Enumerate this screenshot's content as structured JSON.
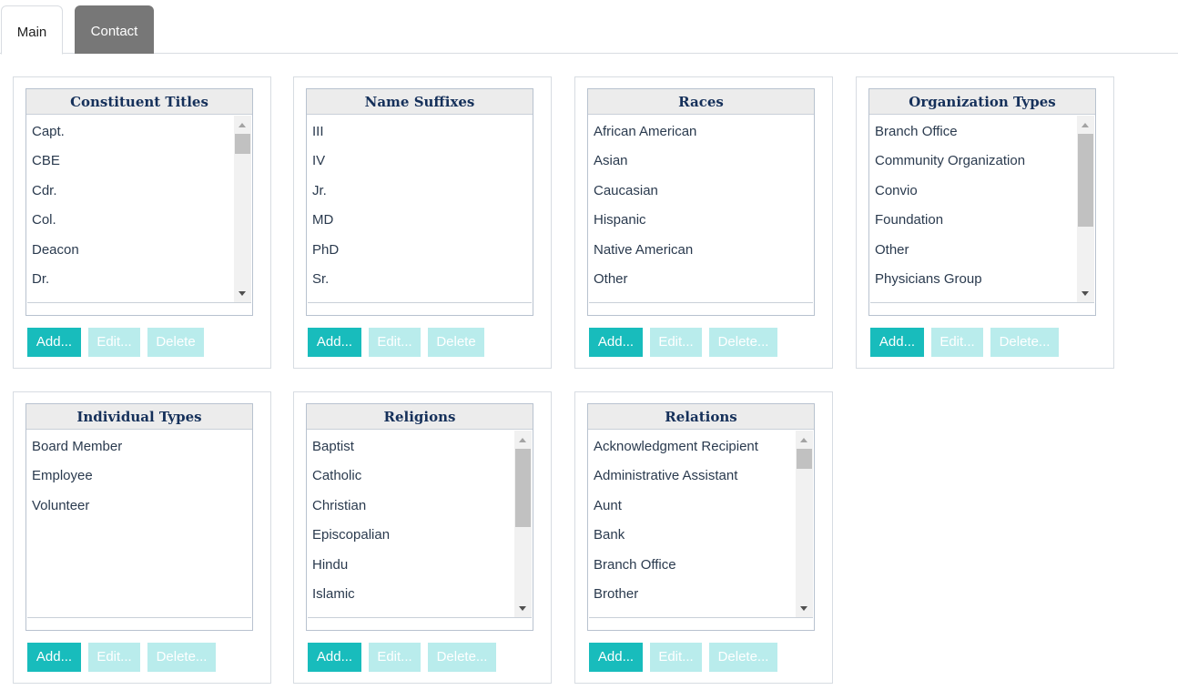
{
  "tabs": [
    {
      "label": "Main",
      "active": true
    },
    {
      "label": "Contact",
      "active": false
    }
  ],
  "colors": {
    "accent": "#18bcbc",
    "accent_disabled": "#b9ecec",
    "header_text": "#15305a",
    "tab_inactive": "#777777"
  },
  "panels": [
    {
      "title": "Constituent Titles",
      "items": [
        "Capt.",
        "CBE",
        "Cdr.",
        "Col.",
        "Deacon",
        "Dr."
      ],
      "has_scrollbar": true,
      "buttons": {
        "add": "Add...",
        "edit": "Edit...",
        "delete": "Delete"
      }
    },
    {
      "title": "Name Suffixes",
      "items": [
        "III",
        "IV",
        "Jr.",
        "MD",
        "PhD",
        "Sr."
      ],
      "has_scrollbar": false,
      "buttons": {
        "add": "Add...",
        "edit": "Edit...",
        "delete": "Delete"
      }
    },
    {
      "title": "Races",
      "items": [
        "African American",
        "Asian",
        "Caucasian",
        "Hispanic",
        "Native American",
        "Other"
      ],
      "has_scrollbar": false,
      "buttons": {
        "add": "Add...",
        "edit": "Edit...",
        "delete": "Delete..."
      }
    },
    {
      "title": "Organization Types",
      "items": [
        "Branch Office",
        "Community Organization",
        "Convio",
        "Foundation",
        "Other",
        "Physicians Group"
      ],
      "has_scrollbar": true,
      "buttons": {
        "add": "Add...",
        "edit": "Edit...",
        "delete": "Delete..."
      }
    },
    {
      "title": "Individual Types",
      "items": [
        "Board Member",
        "Employee",
        "Volunteer"
      ],
      "has_scrollbar": false,
      "buttons": {
        "add": "Add...",
        "edit": "Edit...",
        "delete": "Delete..."
      }
    },
    {
      "title": "Religions",
      "items": [
        "Baptist",
        "Catholic",
        "Christian",
        "Episcopalian",
        "Hindu",
        "Islamic"
      ],
      "has_scrollbar": true,
      "buttons": {
        "add": "Add...",
        "edit": "Edit...",
        "delete": "Delete..."
      }
    },
    {
      "title": "Relations",
      "items": [
        "Acknowledgment Recipient",
        "Administrative Assistant",
        "Aunt",
        "Bank",
        "Branch Office",
        "Brother"
      ],
      "has_scrollbar": true,
      "buttons": {
        "add": "Add...",
        "edit": "Edit...",
        "delete": "Delete..."
      }
    }
  ]
}
